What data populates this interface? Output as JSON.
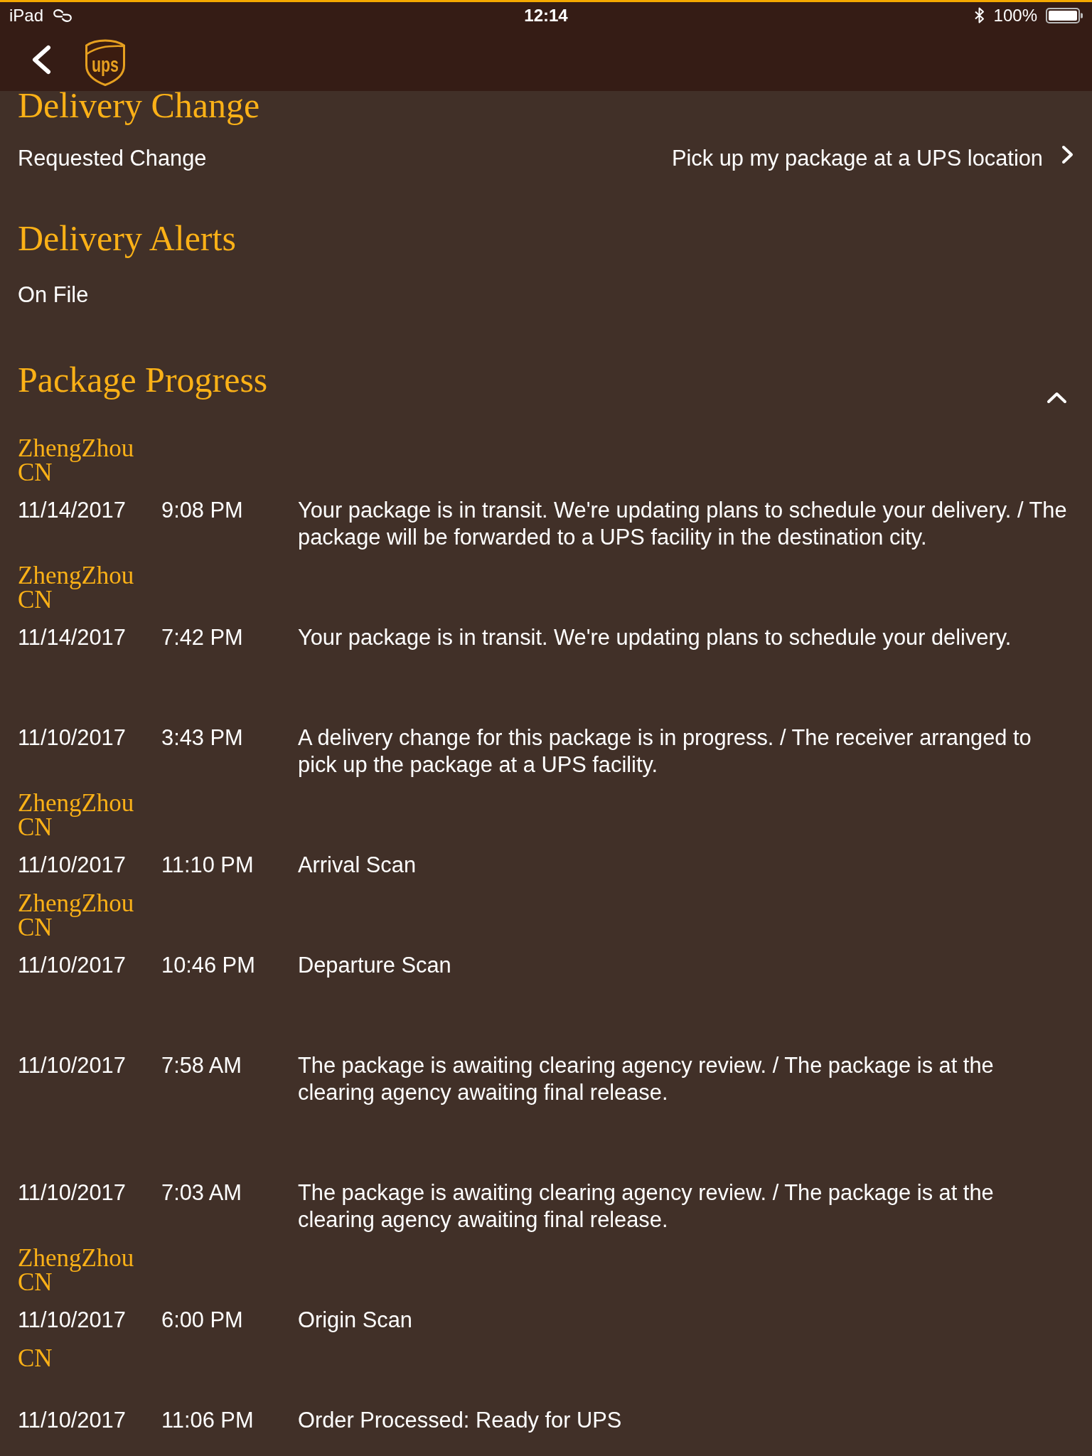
{
  "status_bar": {
    "device": "iPad",
    "time": "12:14",
    "battery": "100%"
  },
  "header": {
    "logo_text": "ups"
  },
  "delivery_change": {
    "title": "Delivery Change",
    "label": "Requested Change",
    "value": "Pick up my package at a UPS location"
  },
  "delivery_alerts": {
    "title": "Delivery Alerts",
    "value": "On File"
  },
  "package_progress": {
    "title": "Package Progress",
    "expanded": true,
    "events": [
      {
        "location": "ZhengZhou\nCN",
        "date": "11/14/2017",
        "time": "9:08 PM",
        "description": "Your package is in transit. We're updating plans to schedule your delivery. / The package will be forwarded to a UPS facility in the destination city."
      },
      {
        "location": "ZhengZhou\nCN",
        "date": "11/14/2017",
        "time": "7:42 PM",
        "description": "Your package is in transit. We're updating plans to schedule your delivery."
      },
      {
        "date": "11/10/2017",
        "time": "3:43 PM",
        "description": "A delivery change for this package is in progress. / The receiver arranged to pick up the package at a UPS facility."
      },
      {
        "location": "ZhengZhou\nCN",
        "date": "11/10/2017",
        "time": "11:10 PM",
        "description": "Arrival Scan"
      },
      {
        "location": "ZhengZhou\nCN",
        "date": "11/10/2017",
        "time": "10:46 PM",
        "description": "Departure Scan"
      },
      {
        "date": "11/10/2017",
        "time": "7:58 AM",
        "description": "The package is awaiting clearing agency review. / The package is at the clearing agency awaiting final release."
      },
      {
        "date": "11/10/2017",
        "time": "7:03 AM",
        "description": "The package is awaiting clearing agency review. / The package is at the clearing agency awaiting final release."
      },
      {
        "location": "ZhengZhou\nCN",
        "date": "11/10/2017",
        "time": "6:00 PM",
        "description": "Origin Scan"
      },
      {
        "location": "CN",
        "date": "11/10/2017",
        "time": "11:06 PM",
        "description": "Order Processed: Ready for UPS"
      }
    ]
  }
}
